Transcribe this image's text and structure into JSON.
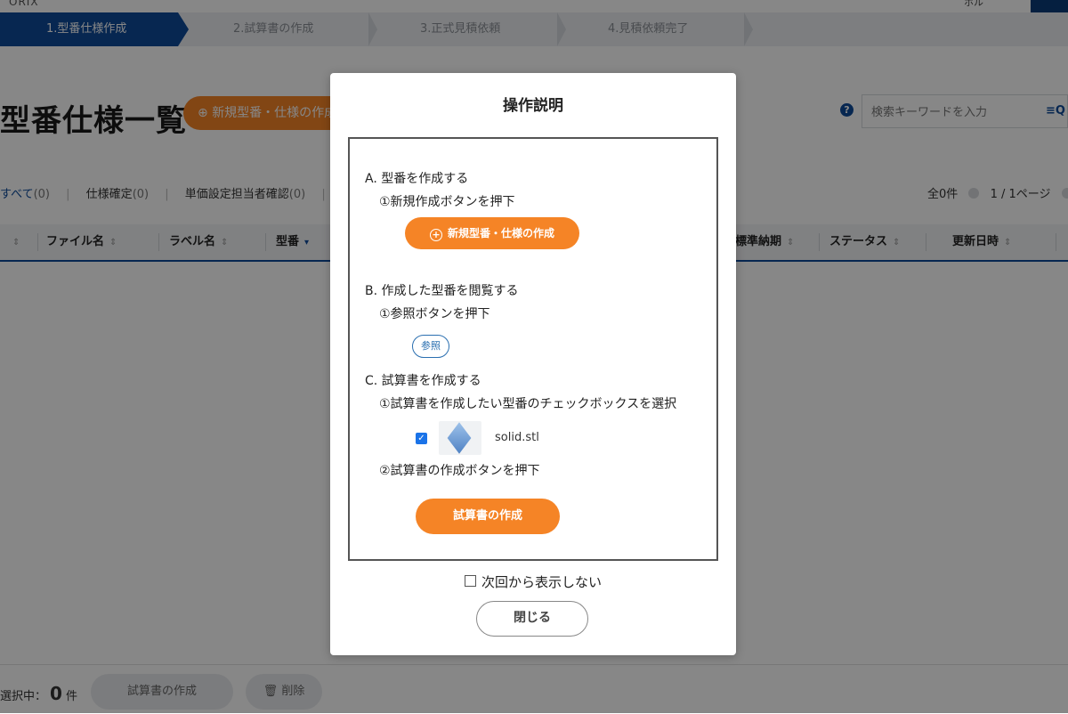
{
  "header": {
    "logo": "ORIX",
    "user": "ホル"
  },
  "steps": [
    "1.型番仕様作成",
    "2.試算書の作成",
    "3.正式見積依頼",
    "4.見積依頼完了"
  ],
  "page": {
    "title": "型番仕様一覧",
    "new_button": "新規型番・仕様の作成",
    "search_placeholder": "検索キーワードを入力"
  },
  "filters": [
    {
      "name": "すべて",
      "count": "(0)"
    },
    {
      "name": "仕様確定",
      "count": "(0)"
    },
    {
      "name": "単価設定担当者確認",
      "count": "(0)"
    }
  ],
  "pager": {
    "total": "全0件",
    "pages": "1 / 1ページ"
  },
  "table_headers": [
    "ファイル名",
    "ラベル名",
    "型番",
    "標準納期",
    "ステータス",
    "更新日時"
  ],
  "footer": {
    "selected_label": "選択中：",
    "selected_count": "0",
    "unit": "件",
    "calc_button": "試算書の作成",
    "delete_button": "削除"
  },
  "modal": {
    "title": "操作説明",
    "section_a": {
      "heading": "A. 型番を作成する",
      "step1": "①新規作成ボタンを押下",
      "demo_button": "新規型番・仕様の作成"
    },
    "section_b": {
      "heading": "B. 作成した型番を閲覧する",
      "step1": "①参照ボタンを押下",
      "demo_button": "参照"
    },
    "section_c": {
      "heading": "C. 試算書を作成する",
      "step1": "①試算書を作成したい型番のチェックボックスを選択",
      "demo_file": "solid.stl",
      "step2": "②試算書の作成ボタンを押下",
      "demo_button": "試算書の作成"
    },
    "dont_show": "次回から表示しない",
    "close_button": "閉じる"
  }
}
